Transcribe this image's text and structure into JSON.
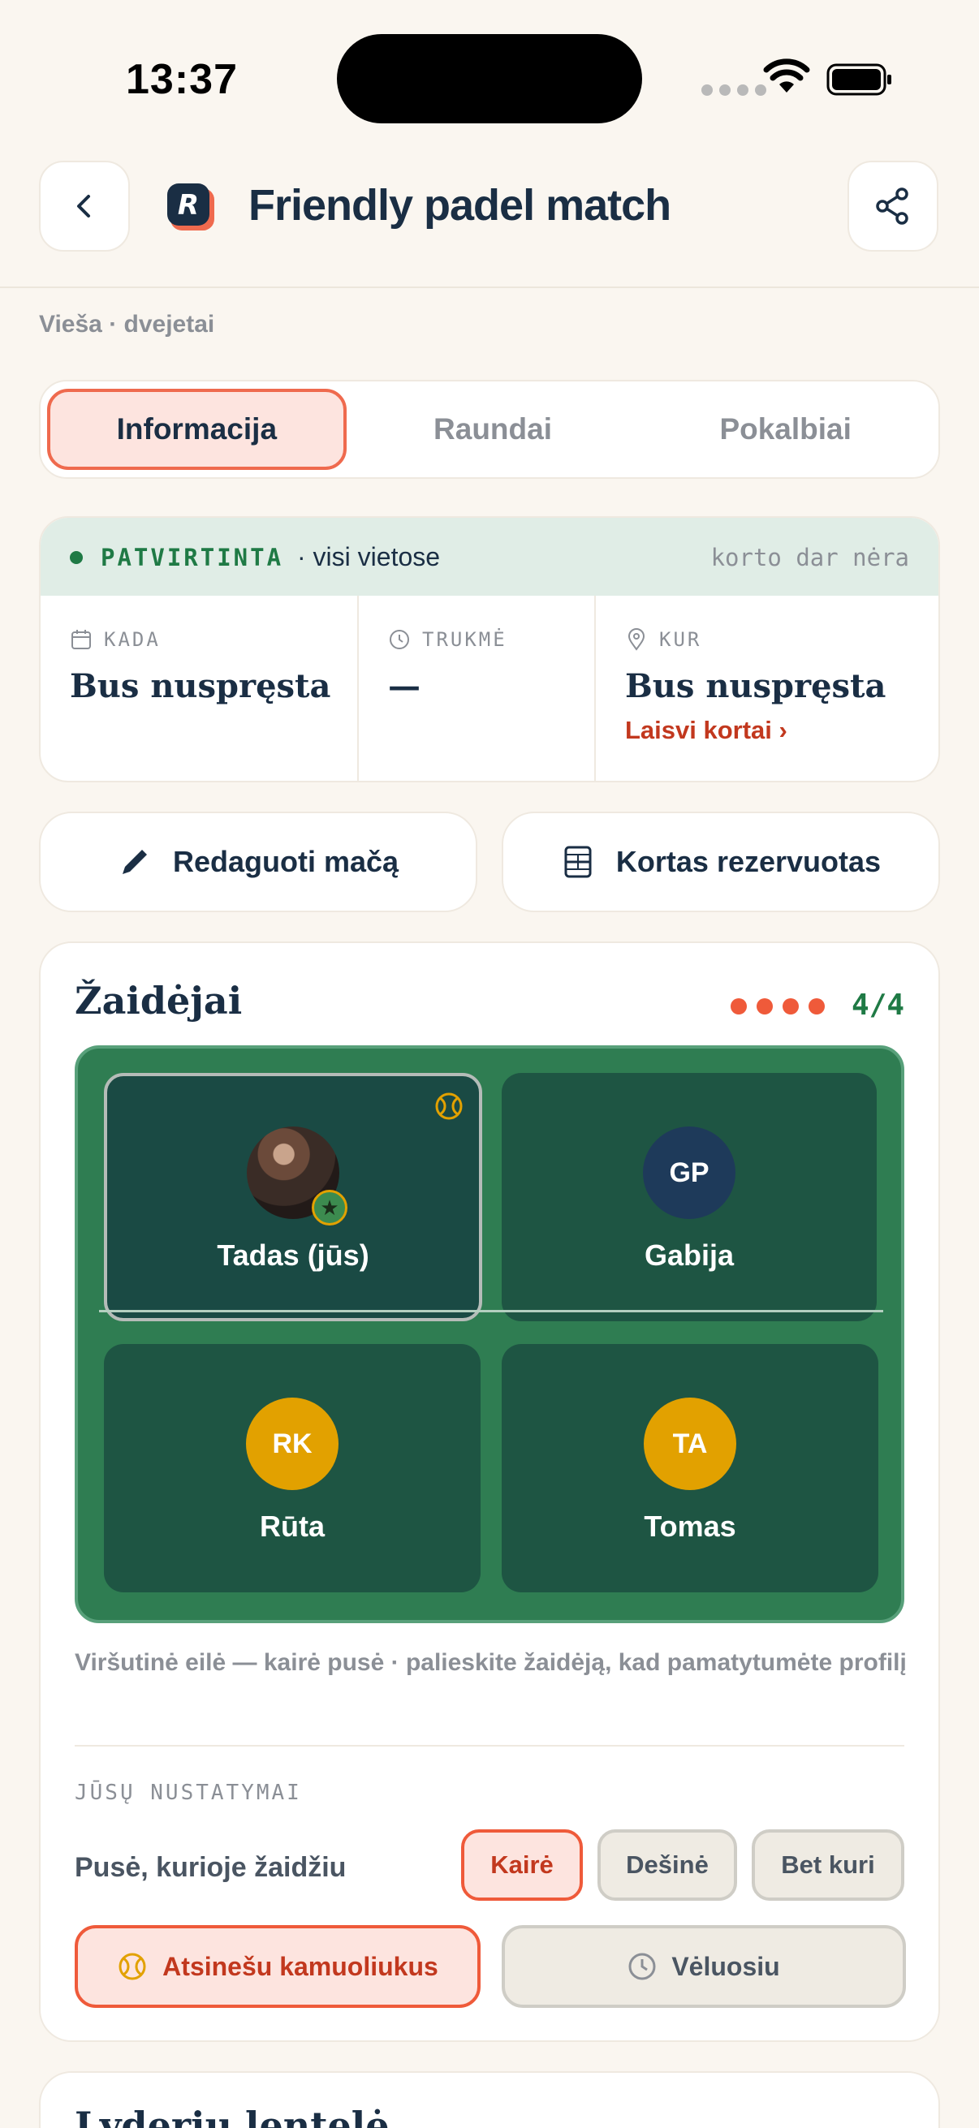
{
  "status_bar": {
    "time": "13:37"
  },
  "header": {
    "title": "Friendly padel match",
    "subtitle": "Vieša · dvejetai"
  },
  "tabs": [
    {
      "label": "Informacija",
      "active": true
    },
    {
      "label": "Raundai",
      "active": false
    },
    {
      "label": "Pokalbiai",
      "active": false
    }
  ],
  "info": {
    "status": "PATVIRTINTA",
    "status_extra": "· visi vietose",
    "court_note": "korto dar nėra",
    "when": {
      "label": "KADA",
      "value": "Bus nuspręsta"
    },
    "duration": {
      "label": "TRUKMĖ",
      "value": "—"
    },
    "where": {
      "label": "KUR",
      "value": "Bus nuspręsta",
      "link": "Laisvi kortai ›"
    }
  },
  "actions": {
    "edit": "Redaguoti mačą",
    "court_booked": "Kortas rezervuotas"
  },
  "players": {
    "title": "Žaidėjai",
    "count": "4/4",
    "list": [
      {
        "name": "Tadas (jūs)",
        "initials": "",
        "photo": true,
        "me": true
      },
      {
        "name": "Gabija",
        "initials": "GP"
      },
      {
        "name": "Rūta",
        "initials": "RK"
      },
      {
        "name": "Tomas",
        "initials": "TA"
      }
    ],
    "hint": "Viršutinė eilė — kairė pusė · palieskite žaidėją, kad pamatytumėte profilį"
  },
  "settings": {
    "label": "JŪSŲ NUSTATYMAI",
    "side_label": "Pusė, kurioje žaidžiu",
    "sides": [
      "Kairė",
      "Dešinė",
      "Bet kuri"
    ],
    "selected_side": "Kairė",
    "bring_balls": "Atsinešu kamuoliukus",
    "late": "Vėluosiu"
  },
  "leaderboard": {
    "title": "Lyderių lentelė"
  },
  "colors": {
    "accent": "#ef5a3a",
    "navy": "#1a2e44",
    "court": "#2f7d52",
    "confirmed": "#1f7a45"
  }
}
